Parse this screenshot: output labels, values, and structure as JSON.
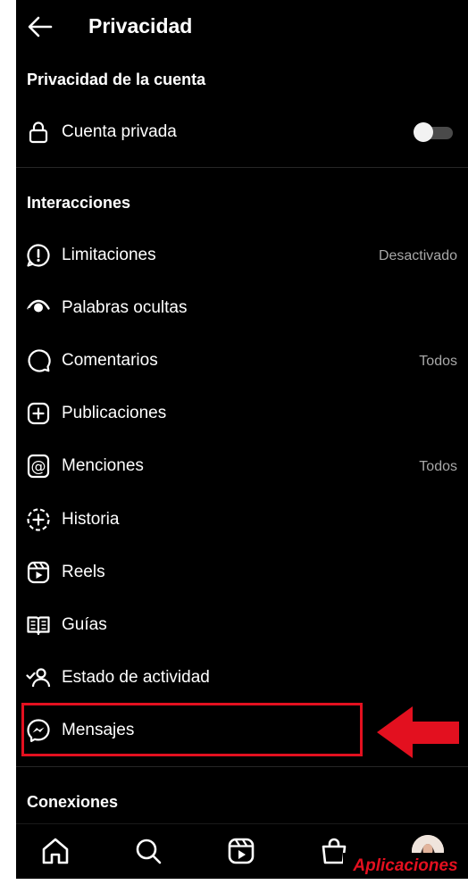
{
  "header": {
    "title": "Privacidad"
  },
  "sections": {
    "account": "Privacidad de la cuenta",
    "interactions": "Interacciones",
    "connections": "Conexiones"
  },
  "private_account": {
    "label": "Cuenta privada",
    "enabled": false
  },
  "items": [
    {
      "label": "Limitaciones",
      "value": "Desactivado",
      "icon": "alert-circle-icon"
    },
    {
      "label": "Palabras ocultas",
      "value": "",
      "icon": "hidden-words-icon"
    },
    {
      "label": "Comentarios",
      "value": "Todos",
      "icon": "comment-icon"
    },
    {
      "label": "Publicaciones",
      "value": "",
      "icon": "plus-square-icon"
    },
    {
      "label": "Menciones",
      "value": "Todos",
      "icon": "at-sign-icon"
    },
    {
      "label": "Historia",
      "value": "",
      "icon": "story-plus-icon"
    },
    {
      "label": "Reels",
      "value": "",
      "icon": "reels-icon"
    },
    {
      "label": "Guías",
      "value": "",
      "icon": "guides-icon"
    },
    {
      "label": "Estado de actividad",
      "value": "",
      "icon": "activity-status-icon"
    },
    {
      "label": "Mensajes",
      "value": "",
      "icon": "messenger-icon"
    }
  ],
  "bottom_nav": [
    "home-icon",
    "search-icon",
    "reels-icon",
    "shop-icon",
    "profile-avatar"
  ],
  "watermark": "Aplicaciones",
  "colors": {
    "background": "#000000",
    "text": "#ffffff",
    "secondary": "#a8a8a8",
    "accent_red": "#e3101f"
  }
}
